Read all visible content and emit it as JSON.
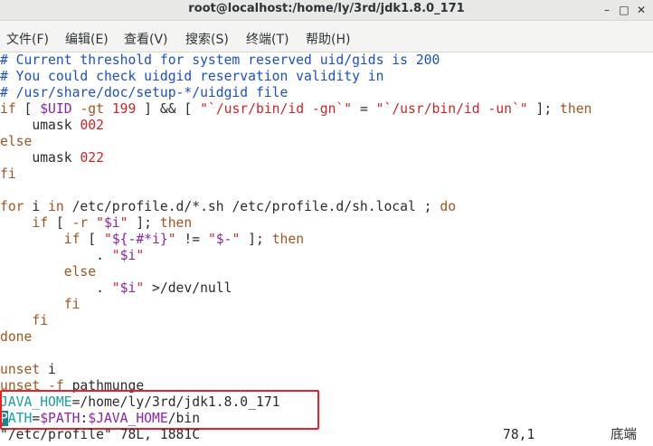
{
  "window": {
    "title": "root@localhost:/home/ly/3rd/jdk1.8.0_171",
    "buttons": {
      "minimize": "–",
      "maximize": "□",
      "close": "✕"
    }
  },
  "menu": {
    "items": [
      "文件(F)",
      "编辑(E)",
      "查看(V)",
      "搜索(S)",
      "终端(T)",
      "帮助(H)"
    ]
  },
  "editor": {
    "lines": [
      "# Current threshold for system reserved uid/gids is 200",
      "# You could check uidgid reservation validity in",
      "# /usr/share/doc/setup-*/uidgid file",
      "if [ $UID -gt 199 ] && [ \"`/usr/bin/id -gn`\" = \"`/usr/bin/id -un`\" ]; then",
      "    umask 002",
      "else",
      "    umask 022",
      "fi",
      "",
      "for i in /etc/profile.d/*.sh /etc/profile.d/sh.local ; do",
      "    if [ -r \"$i\" ]; then",
      "        if [ \"${-#*i}\" != \"$-\" ]; then",
      "            . \"$i\"",
      "        else",
      "            . \"$i\" >/dev/null",
      "        fi",
      "    fi",
      "done",
      "",
      "unset i",
      "unset -f pathmunge",
      "JAVA_HOME=/home/ly/3rd/jdk1.8.0_171",
      "PATH=$PATH:$JAVA_HOME/bin"
    ]
  },
  "status": {
    "file_info": "\"/etc/profile\" 78L, 1881C",
    "position": "78,1",
    "scroll": "底端"
  }
}
